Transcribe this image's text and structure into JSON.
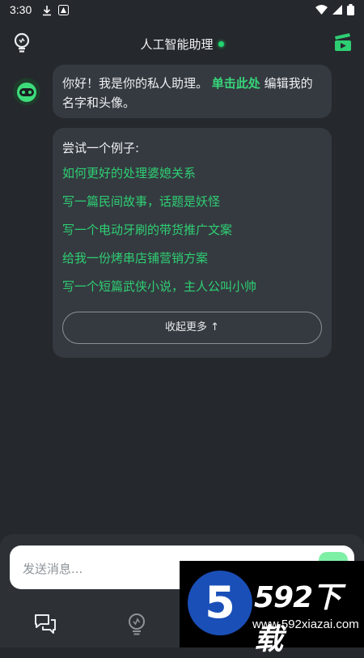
{
  "status_bar": {
    "time": "3:30"
  },
  "header": {
    "title": "人工智能助理"
  },
  "greeting": {
    "text_before": "你好！我是你的私人助理。",
    "link": "单击此处",
    "text_after": "编辑我的名字和头像。"
  },
  "examples": {
    "title": "尝试一个例子:",
    "items": [
      "如何更好的处理婆媳关系",
      "写一篇民间故事，话题是妖怪",
      "写一个电动牙刷的带货推广文案",
      "给我一份烤串店铺营销方案",
      "写一个短篇武侠小说，主人公叫小帅"
    ],
    "collapse_label": "收起更多 ↑"
  },
  "input": {
    "placeholder": "发送消息..."
  },
  "watermark": {
    "badge": "5",
    "brand": "592下载",
    "url": "www.592xiazai.com"
  },
  "colors": {
    "background": "#25282c",
    "bubble": "#353a40",
    "accent": "#2ecf73"
  }
}
